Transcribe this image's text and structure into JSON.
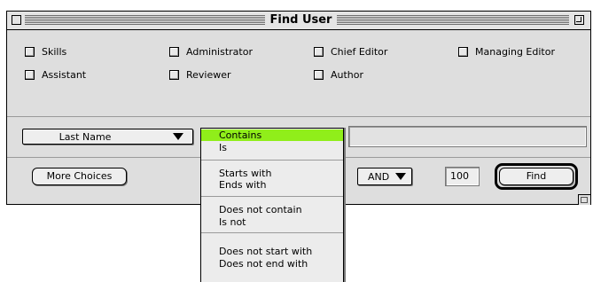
{
  "window": {
    "title": "Find User"
  },
  "roles": {
    "skills": "Skills",
    "administrator": "Administrator",
    "chief_editor": "Chief Editor",
    "managing_editor": "Managing Editor",
    "assistant": "Assistant",
    "reviewer": "Reviewer",
    "author": "Author"
  },
  "criteria": {
    "field_selected": "Last Name",
    "search_value": ""
  },
  "operator_menu": {
    "items": [
      "Contains",
      "Is",
      "Starts with",
      "Ends with",
      "Does not contain",
      "Is not",
      "Does not start with",
      "Does not end with"
    ],
    "selected": "Contains"
  },
  "footer": {
    "more_choices_label": "More Choices",
    "logic_selected": "AND",
    "limit_value": "100",
    "find_label": "Find"
  },
  "colors": {
    "menu_highlight": "#90ee1a"
  }
}
